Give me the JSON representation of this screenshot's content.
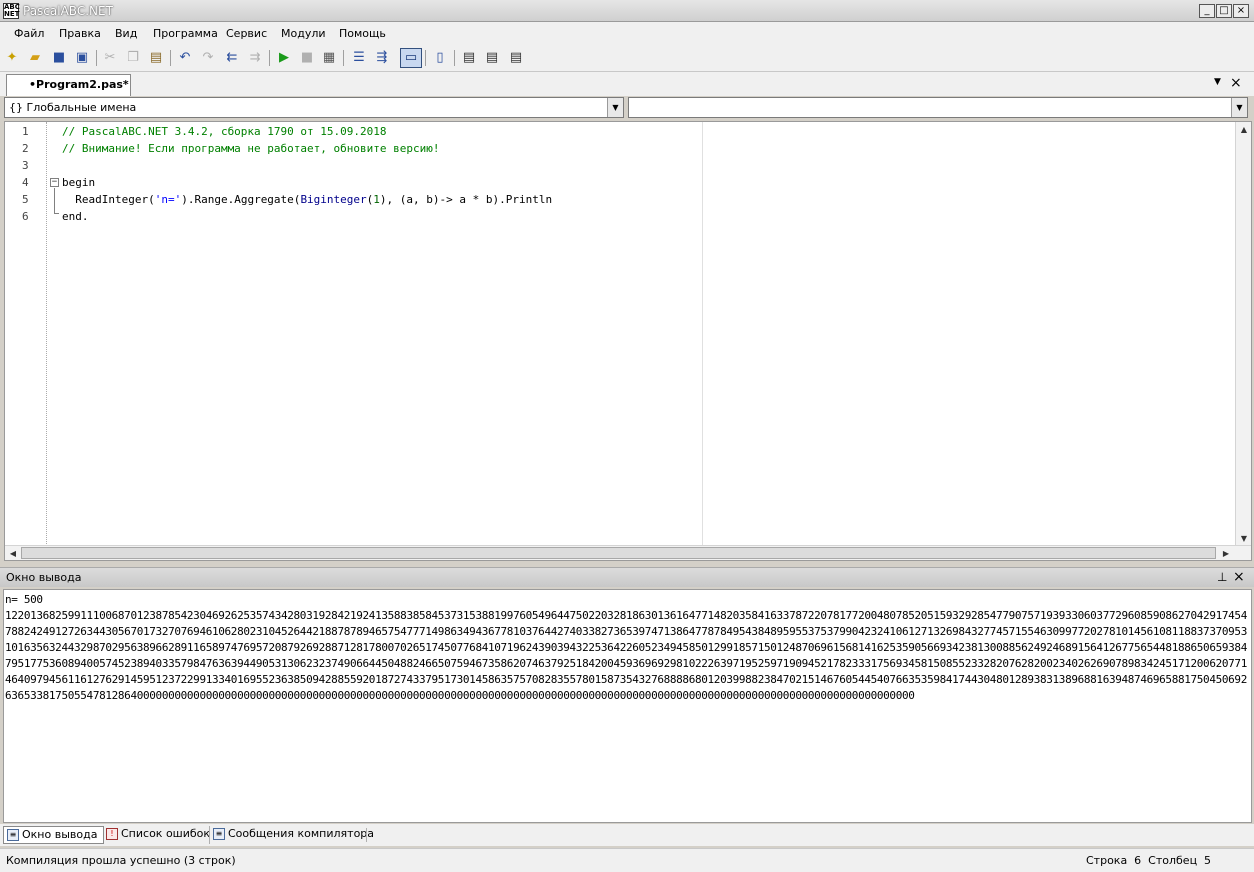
{
  "window": {
    "title": "PascalABC.NET",
    "app_icon_text": "ABC\nNET"
  },
  "window_controls": {
    "minimize": "_",
    "maximize": "□",
    "close": "×"
  },
  "menu": [
    "Файл",
    "Правка",
    "Вид",
    "Программа",
    "Сервис",
    "Модули",
    "Помощь"
  ],
  "tabs": {
    "file_tab": "•Program2.pas*",
    "menu_arrow": "▼",
    "close": "×"
  },
  "combos": {
    "left": "{} Глобальные имена",
    "right": ""
  },
  "editor": {
    "line_numbers": [
      "1",
      "2",
      "3",
      "4",
      "5",
      "6"
    ],
    "lines": [
      {
        "parts": [
          {
            "t": "// PascalABC.NET 3.4.2, сборка 1790 от 15.09.2018",
            "c": "comment"
          }
        ]
      },
      {
        "parts": [
          {
            "t": "// Внимание! Если программа не работает, обновите версию!",
            "c": "comment"
          }
        ]
      },
      {
        "parts": []
      },
      {
        "parts": [
          {
            "t": "begin",
            "c": "key"
          }
        ]
      },
      {
        "parts": [
          {
            "t": "  ReadInteger(",
            "c": "key"
          },
          {
            "t": "'n='",
            "c": "str"
          },
          {
            "t": ").Range.Aggregate(",
            "c": "key"
          },
          {
            "t": "Biginteger",
            "c": "type"
          },
          {
            "t": "(",
            "c": "key"
          },
          {
            "t": "1",
            "c": "num"
          },
          {
            "t": "), (a, b)-> a * b).Println",
            "c": "key"
          }
        ]
      },
      {
        "parts": [
          {
            "t": "end.",
            "c": "key"
          }
        ]
      }
    ]
  },
  "output_panel": {
    "title": "Окно вывода",
    "pin": "📌",
    "close": "×",
    "lines": [
      "n= 500",
      "1220136825991110068701238785423046926253574342803192842192413588385845373153881997605496447502203281863013616477148203584163378722078177200480785205159329285477907571939330603772960859086270429174547882424912726344305670173270769461062802310452644218878789465754777149863494367781037644274033827365397471386477878495438489595537537990423241061271326984327745715546309977202781014561081188373709531016356324432987029563896628911658974769572087926928871281780070265174507768410719624390394322536422605234945850129918571501248706961568141625359056693423813008856249246891564126775654481886506593847951775360894005745238940335798476363944905313062323749066445048824665075946735862074637925184200459369692981022263971952597190945217823331756934581508552332820762820023402626907898342451712006207714640979456116127629145951237229913340169552363850942885592018727433795173014586357570828355780158735432768888680120399882384702151467605445407663535984174430480128938313896881639487469658817504506926365338175055478128640000000000000000000000000000000000000000000000000000000000000000000000000000000000000000000000000000000000000000000000000000"
    ]
  },
  "bottom_tabs": [
    "Окно вывода",
    "Список ошибок",
    "Сообщения компилятора"
  ],
  "status": {
    "left": "Компиляция прошла успешно (3 строк)",
    "right": "Строка  6  Столбец  5"
  }
}
